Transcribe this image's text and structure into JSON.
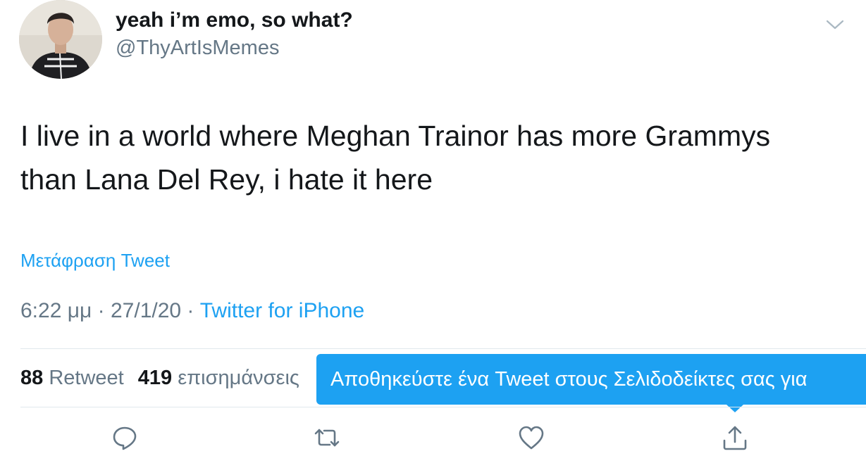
{
  "user": {
    "display_name": "yeah i’m emo, so what?",
    "handle": "@ThyArtIsMemes",
    "avatar_icon": "avatar-photo"
  },
  "tweet": {
    "text_line1": "I live in a world where Meghan Trainor has more Grammys",
    "text_line2": "than Lana Del Rey, i hate it here",
    "translate_label": "Μετάφραση Tweet",
    "time": "6:22 μμ",
    "separator": "·",
    "date": "27/1/20",
    "source": "Twitter for iPhone"
  },
  "stats": {
    "retweets_count": "88",
    "retweets_label": "Retweet",
    "likes_count": "419",
    "likes_label": "επισημάνσεις"
  },
  "tooltip": {
    "text": "Αποθηκεύστε ένα Tweet στους Σελιδοδείκτες σας για"
  },
  "actions": {
    "reply_icon": "reply-icon",
    "retweet_icon": "retweet-icon",
    "like_icon": "heart-icon",
    "share_icon": "share-icon"
  },
  "colors": {
    "accent": "#1da1f2",
    "secondary_text": "#657786",
    "primary_text": "#14171a",
    "divider": "#e1e8ed"
  }
}
